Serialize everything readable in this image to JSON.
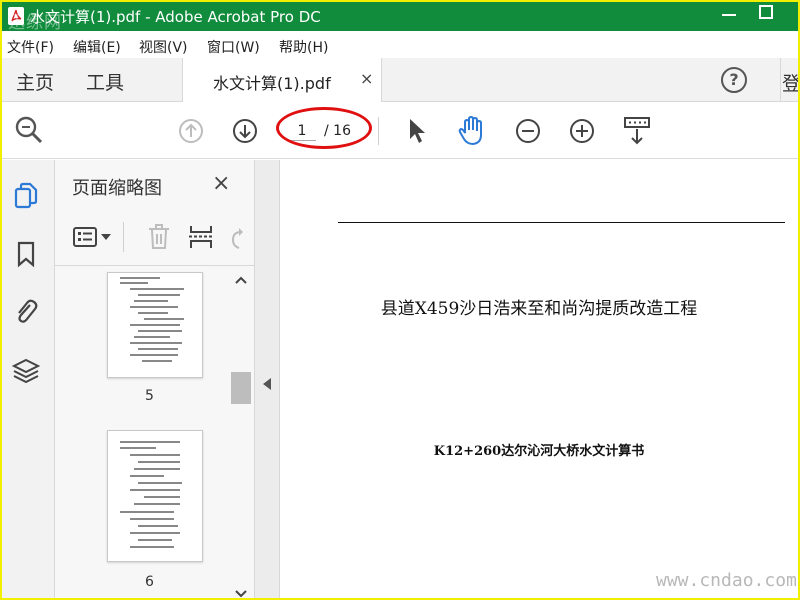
{
  "window": {
    "title": "水文计算(1).pdf - Adobe Acrobat Pro DC",
    "logo_watermark": "迅练网",
    "accent": "#108c3c"
  },
  "menu": {
    "items": [
      "文件(F)",
      "编辑(E)",
      "视图(V)",
      "窗口(W)",
      "帮助(H)"
    ]
  },
  "tabs": {
    "home": "主页",
    "tools": "工具",
    "document": "水文计算(1).pdf",
    "close_symbol": "×",
    "help_symbol": "?",
    "login": "登"
  },
  "toolbar": {
    "search_icon": "magnifier-icon",
    "current_page": "1",
    "total_pages": "/ 16",
    "highlight_color": "#e01010",
    "hand_color": "#2d7ad6"
  },
  "sidebar": {
    "icons": [
      "pages-icon",
      "bookmark-icon",
      "attachment-icon",
      "layers-icon"
    ],
    "active_color": "#2d7ad6"
  },
  "thumbnails": {
    "title": "页面缩略图",
    "close_symbol": "×",
    "pages": [
      {
        "label": "5"
      },
      {
        "label": "6"
      }
    ]
  },
  "document": {
    "title": "县道X459沙日浩来至和尚沟提质改造工程",
    "subtitle": "K12+260达尔沁河大桥水文计算书"
  },
  "footer_watermark": "www.cndao.com"
}
